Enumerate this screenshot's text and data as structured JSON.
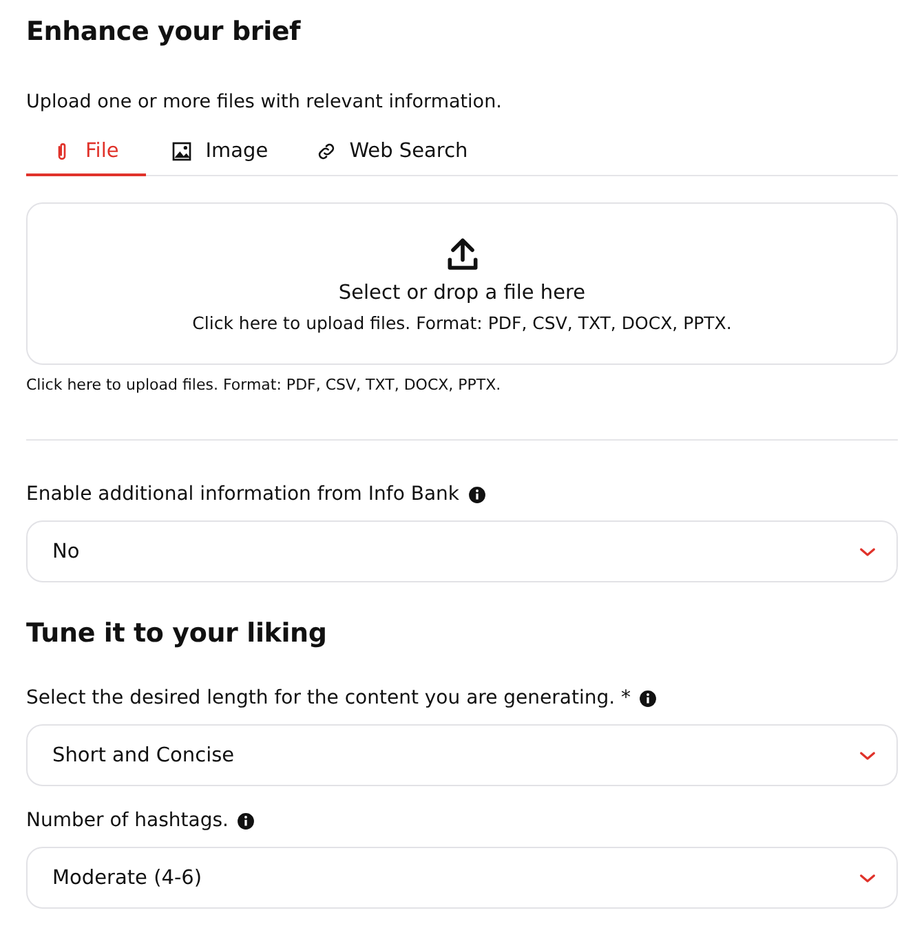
{
  "brief": {
    "title": "Enhance your brief",
    "description": "Upload one or more files with relevant information.",
    "tabs": [
      {
        "label": "File",
        "kind": "clip",
        "selected": true
      },
      {
        "label": "Image",
        "kind": "image",
        "selected": false
      },
      {
        "label": "Web Search",
        "kind": "link",
        "selected": false
      }
    ],
    "dropzone": {
      "title": "Select or drop a file here",
      "hint": "Click here to upload files. Format: PDF, CSV, TXT, DOCX, PPTX."
    },
    "note": "Click here to upload files. Format: PDF, CSV, TXT, DOCX, PPTX."
  },
  "info_bank": {
    "label": "Enable additional information from Info Bank",
    "info": true,
    "value": "No"
  },
  "tune": {
    "title": "Tune it to your liking",
    "fields": [
      {
        "label": "Select the desired length for the content you are generating. *",
        "info": true,
        "value": "Short and Concise"
      },
      {
        "label": "Number of hashtags.",
        "info": true,
        "value": "Moderate (4-6)"
      }
    ]
  }
}
